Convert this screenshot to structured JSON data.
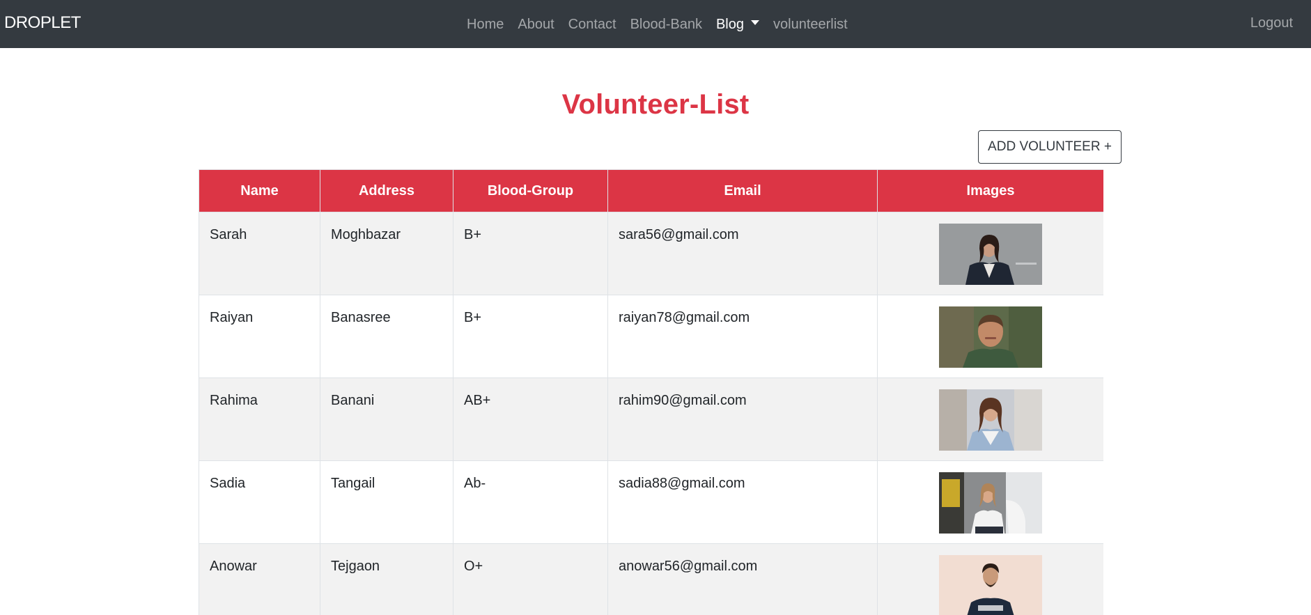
{
  "navbar": {
    "brand": "DROPLET",
    "links": [
      "Home",
      "About",
      "Contact",
      "Blood-Bank",
      "Blog",
      "volunteerlist"
    ],
    "logout": "Logout"
  },
  "page": {
    "title": "Volunteer-List",
    "add_button": "ADD VOLUNTEER +"
  },
  "table": {
    "headers": [
      "Name",
      "Address",
      "Blood-Group",
      "Email",
      "Images"
    ],
    "rows": [
      {
        "name": "Sarah",
        "address": "Moghbazar",
        "blood_group": "B+",
        "email": "sara56@gmail.com"
      },
      {
        "name": "Raiyan",
        "address": "Banasree",
        "blood_group": "B+",
        "email": "raiyan78@gmail.com"
      },
      {
        "name": "Rahima",
        "address": "Banani",
        "blood_group": "AB+",
        "email": "rahim90@gmail.com"
      },
      {
        "name": "Sadia",
        "address": "Tangail",
        "blood_group": "Ab-",
        "email": "sadia88@gmail.com"
      },
      {
        "name": "Anowar",
        "address": "Tejgaon",
        "blood_group": "O+",
        "email": "anowar56@gmail.com"
      }
    ]
  },
  "colors": {
    "navbar_bg": "#343a40",
    "accent": "#dc3545",
    "row_stripe": "#f2f2f2"
  }
}
